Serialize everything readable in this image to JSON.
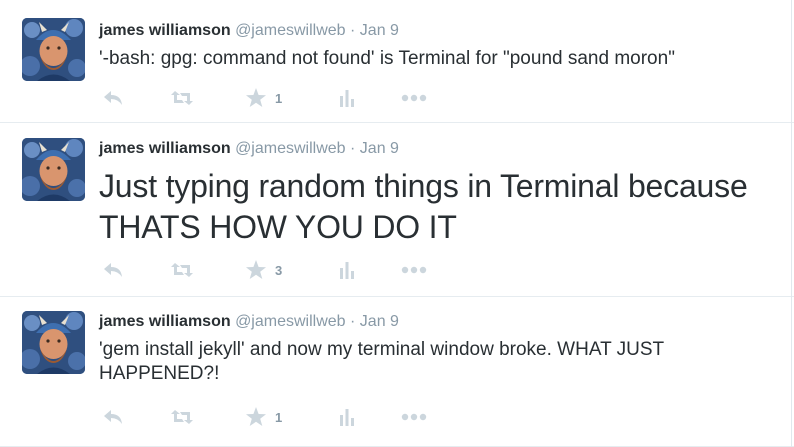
{
  "tweets": [
    {
      "fullname": "james williamson",
      "handle": "@jameswillweb",
      "separator": "·",
      "date": "Jan 9",
      "text": "'-bash: gpg: command not found' is Terminal for \"pound sand moron\"",
      "favorite_count": "1"
    },
    {
      "fullname": "james williamson",
      "handle": "@jameswillweb",
      "separator": "·",
      "date": "Jan 9",
      "text": "Just typing random things in Terminal because THATS HOW YOU DO IT",
      "favorite_count": "3"
    },
    {
      "fullname": "james williamson",
      "handle": "@jameswillweb",
      "separator": "·",
      "date": "Jan 9",
      "text": "'gem install jekyll' and now my terminal window broke. WHAT JUST HAPPENED?!",
      "favorite_count": "1"
    }
  ],
  "icons": {
    "reply": "reply-icon",
    "retweet": "retweet-icon",
    "favorite": "star-icon",
    "stats": "stats-icon",
    "more": "more-icon"
  },
  "colors": {
    "name": "#292f33",
    "meta": "#8899a6",
    "action_icon": "#ccd6dd",
    "divider": "#e6ecf0"
  }
}
